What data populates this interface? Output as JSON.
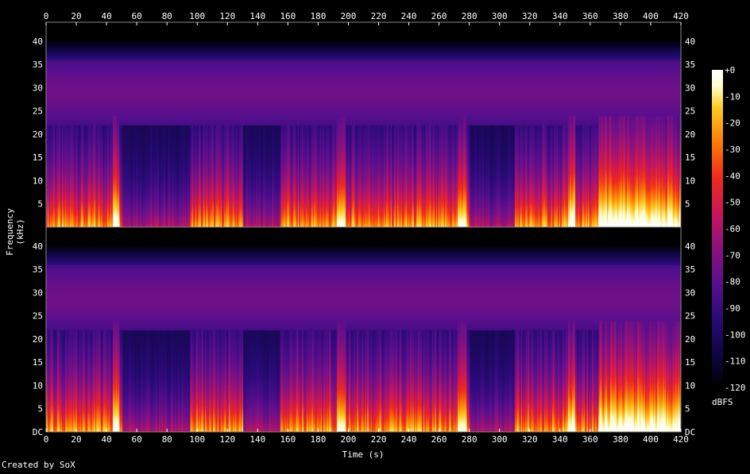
{
  "chart_data": {
    "type": "heatmap",
    "title": "",
    "xlabel": "Time (s)",
    "ylabel": "Frequency (kHz)",
    "x_ticks": [
      0,
      20,
      40,
      60,
      80,
      100,
      120,
      140,
      160,
      180,
      200,
      220,
      240,
      260,
      280,
      300,
      320,
      340,
      360,
      380,
      400,
      420
    ],
    "xlim": [
      0,
      420
    ],
    "y_ticks": [
      "DC",
      "5",
      "10",
      "15",
      "20",
      "25",
      "30",
      "35",
      "40"
    ],
    "ylim_khz": [
      0,
      44.1
    ],
    "channels": [
      "channel 1",
      "channel 2"
    ],
    "colorbar": {
      "label": "dBFS",
      "ticks": [
        "+0",
        "-10",
        "-20",
        "-30",
        "-40",
        "-50",
        "-60",
        "-70",
        "-80",
        "-90",
        "-100",
        "-110",
        "-120"
      ],
      "range": [
        -120,
        0
      ]
    },
    "features": {
      "background_band_khz": [
        22,
        36
      ],
      "background_level_dbfs": -90,
      "quiet_regions_s": [
        [
          50,
          95
        ],
        [
          130,
          155
        ],
        [
          280,
          310
        ]
      ],
      "loud_regions_s": [
        [
          345,
          350
        ],
        [
          365,
          420
        ]
      ]
    },
    "credit": "Created by SoX",
    "colors": {
      "background": "#000000",
      "text": "#ffffff",
      "palette": [
        "#000000",
        "#0d0640",
        "#2a0a78",
        "#5a0f8e",
        "#8e127c",
        "#c8175a",
        "#ef2a1c",
        "#fb7a05",
        "#fecb20",
        "#ffffd0",
        "#ffffff"
      ]
    }
  }
}
